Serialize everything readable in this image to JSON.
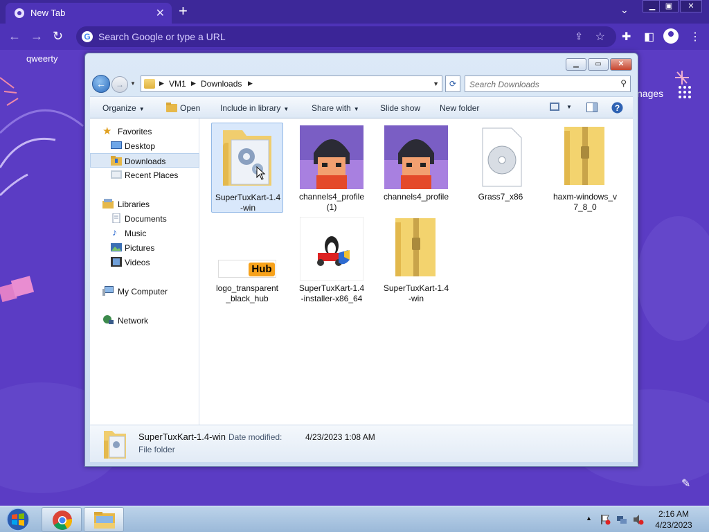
{
  "chrome": {
    "tab_title": "New Tab",
    "tab_close": "✕",
    "new_tab": "+",
    "tab_search": "⌄",
    "omnibox_placeholder": "Search Google or type a URL",
    "bookmark": "qweerty",
    "ntp_images": "nages"
  },
  "explorer": {
    "breadcrumb": [
      "VM1",
      "Downloads"
    ],
    "search_placeholder": "Search Downloads",
    "commands": {
      "organize": "Organize",
      "open": "Open",
      "include_in_library": "Include in library",
      "share_with": "Share with",
      "slide_show": "Slide show",
      "new_folder": "New folder"
    },
    "nav": {
      "favorites": "Favorites",
      "desktop": "Desktop",
      "downloads": "Downloads",
      "recent_places": "Recent Places",
      "libraries": "Libraries",
      "documents": "Documents",
      "music": "Music",
      "pictures": "Pictures",
      "videos": "Videos",
      "my_computer": "My Computer",
      "network": "Network"
    },
    "files": [
      {
        "label": "SuperTuxKart-1.4\n-win",
        "icon": "folder-icon",
        "selected": true
      },
      {
        "label": "channels4_profile\n(1)",
        "icon": "image-thumbnail"
      },
      {
        "label": "channels4_profile",
        "icon": "image-thumbnail"
      },
      {
        "label": "Grass7_x86",
        "icon": "disc-image-icon"
      },
      {
        "label": "haxm-windows_v\n7_8_0",
        "icon": "zip-folder-icon"
      },
      {
        "label": "logo_transparent\n_black_hub",
        "icon": "image-thumbnail"
      },
      {
        "label": "SuperTuxKart-1.4\n-installer-x86_64",
        "icon": "installer-icon"
      },
      {
        "label": "SuperTuxKart-1.4\n-win",
        "icon": "zip-folder-icon"
      }
    ],
    "logo_hub_text": "Hub",
    "details": {
      "name": "SuperTuxKart-1.4-win",
      "modified_label": "Date modified:",
      "modified_value": "4/23/2023 1:08 AM",
      "type": "File folder"
    }
  },
  "taskbar": {
    "time": "2:16 AM",
    "date": "4/23/2023"
  }
}
